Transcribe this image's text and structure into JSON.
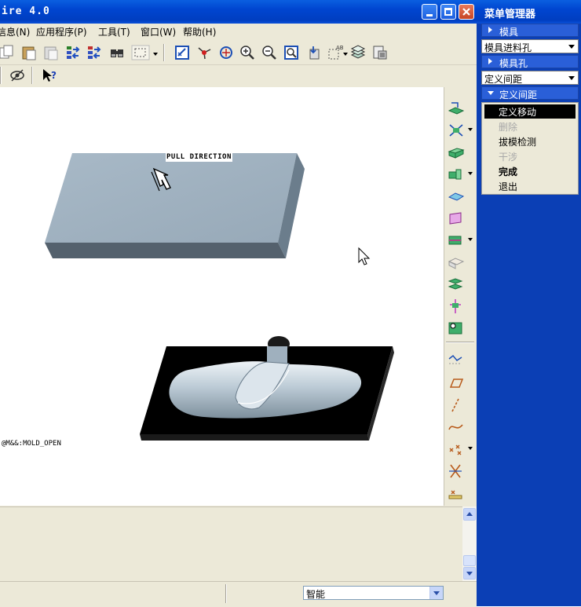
{
  "window": {
    "title": "ire 4.0",
    "minimize_icon": "minimize-icon",
    "maximize_icon": "maximize-icon",
    "close_icon": "close-icon"
  },
  "menubar": [
    {
      "label": "信息(N)"
    },
    {
      "label": "应用程序(P)"
    },
    {
      "label": "工具(T)"
    },
    {
      "label": "窗口(W)"
    },
    {
      "label": "帮助(H)"
    }
  ],
  "toolbar": {
    "icons": [
      "copy-icon",
      "paste-icon",
      "paste-special-icon",
      "regenerate-icon",
      "regenerate-manager-icon",
      "find-icon",
      "select-box-icon",
      "repaint-icon",
      "spin-center-icon",
      "orient-icon",
      "zoom-in-icon",
      "zoom-out-icon",
      "refit-icon",
      "view-manager-icon",
      "named-views-icon",
      "layers-icon",
      "model-tree-icon"
    ],
    "row2_icons": [
      "hide-icon",
      "context-help-icon"
    ]
  },
  "viewport": {
    "pull_direction_label": "PULL DIRECTION",
    "status_text": "@M&&:MOLD_OPEN"
  },
  "right_toolbar": {
    "icons": [
      "mold-refpart-icon",
      "workpiece-icon",
      "shrinkage-icon",
      "runner-icon",
      "parting-surface-icon",
      "volume-icon",
      "split-icon",
      "mold-volume-icon",
      "extract-icon",
      "mold-open-icon",
      "molding-icon",
      "datum-plane-icon",
      "datum-axis-icon",
      "datum-curve-icon",
      "datum-point-icon",
      "coordinate-system-icon",
      "analysis-icon"
    ]
  },
  "statusbar": {
    "filter_value": "智能"
  },
  "menu_manager": {
    "title": "菜单管理器",
    "sections": [
      {
        "label": "模具",
        "expanded": false
      },
      {
        "label": "模具进料孔",
        "type": "combo"
      },
      {
        "label": "模具孔",
        "expanded": false
      },
      {
        "label": "定义间距",
        "type": "combo"
      },
      {
        "label": "定义间距",
        "expanded": true
      }
    ],
    "options": [
      {
        "label": "定义移动",
        "state": "selected"
      },
      {
        "label": "删除",
        "state": "disabled"
      },
      {
        "label": "拔模检测",
        "state": "normal"
      },
      {
        "label": "干涉",
        "state": "disabled"
      },
      {
        "label": "完成",
        "state": "bold"
      },
      {
        "label": "退出",
        "state": "normal"
      }
    ]
  },
  "colors": {
    "title_blue": "#0045d0",
    "menu_manager_bg": "#0b3fb5",
    "window_bg": "#ece9d8",
    "model_grey": "#9fb0be",
    "mold_base": "#000000"
  }
}
